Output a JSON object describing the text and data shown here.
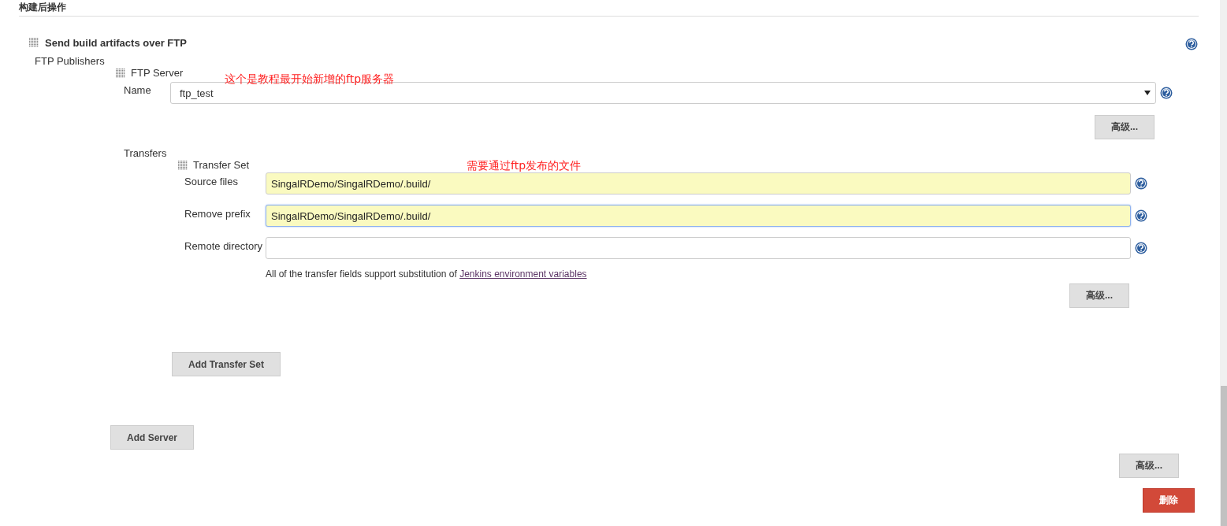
{
  "section_header": "构建后操作",
  "publisher": {
    "title": "Send build artifacts over FTP",
    "label": "FTP Publishers",
    "server": {
      "title": "FTP Server",
      "name_label": "Name",
      "name_value": "ftp_test",
      "annotation": "这个是教程最开始新增的ftp服务器",
      "advanced_button": "高级...",
      "transfers_label": "Transfers",
      "transfer_set": {
        "title": "Transfer Set",
        "annotation": "需要通过ftp发布的文件",
        "fields": [
          {
            "label": "Source files",
            "value": "SingalRDemo/SingalRDemo/.build/",
            "highlighted": true,
            "focused": false
          },
          {
            "label": "Remove prefix",
            "value": "SingalRDemo/SingalRDemo/.build/",
            "highlighted": true,
            "focused": true
          },
          {
            "label": "Remote directory",
            "highlighted": false,
            "focused": false
          }
        ],
        "note": "All of the transfer fields support substitution of ",
        "note_link": "Jenkins environment variables",
        "advanced_button": "高级..."
      },
      "add_transfer_button": "Add Transfer Set"
    },
    "add_server_button": "Add Server",
    "advanced_button": "高级...",
    "delete_button": "删除"
  }
}
